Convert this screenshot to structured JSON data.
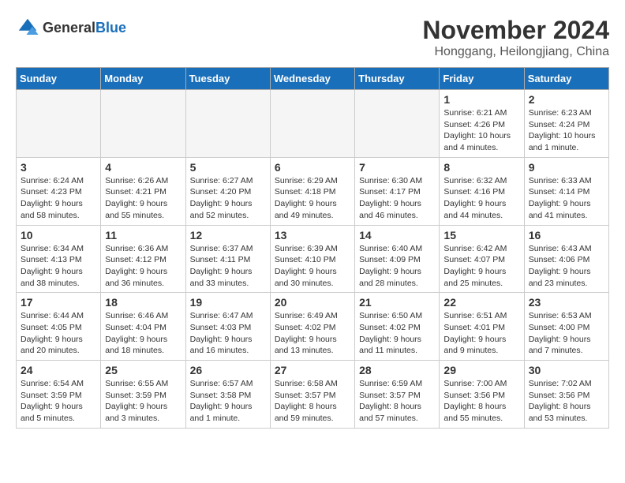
{
  "header": {
    "logo_general": "General",
    "logo_blue": "Blue",
    "month_title": "November 2024",
    "location": "Honggang, Heilongjiang, China"
  },
  "weekdays": [
    "Sunday",
    "Monday",
    "Tuesday",
    "Wednesday",
    "Thursday",
    "Friday",
    "Saturday"
  ],
  "weeks": [
    [
      {
        "day": "",
        "info": ""
      },
      {
        "day": "",
        "info": ""
      },
      {
        "day": "",
        "info": ""
      },
      {
        "day": "",
        "info": ""
      },
      {
        "day": "",
        "info": ""
      },
      {
        "day": "1",
        "info": "Sunrise: 6:21 AM\nSunset: 4:26 PM\nDaylight: 10 hours\nand 4 minutes."
      },
      {
        "day": "2",
        "info": "Sunrise: 6:23 AM\nSunset: 4:24 PM\nDaylight: 10 hours\nand 1 minute."
      }
    ],
    [
      {
        "day": "3",
        "info": "Sunrise: 6:24 AM\nSunset: 4:23 PM\nDaylight: 9 hours\nand 58 minutes."
      },
      {
        "day": "4",
        "info": "Sunrise: 6:26 AM\nSunset: 4:21 PM\nDaylight: 9 hours\nand 55 minutes."
      },
      {
        "day": "5",
        "info": "Sunrise: 6:27 AM\nSunset: 4:20 PM\nDaylight: 9 hours\nand 52 minutes."
      },
      {
        "day": "6",
        "info": "Sunrise: 6:29 AM\nSunset: 4:18 PM\nDaylight: 9 hours\nand 49 minutes."
      },
      {
        "day": "7",
        "info": "Sunrise: 6:30 AM\nSunset: 4:17 PM\nDaylight: 9 hours\nand 46 minutes."
      },
      {
        "day": "8",
        "info": "Sunrise: 6:32 AM\nSunset: 4:16 PM\nDaylight: 9 hours\nand 44 minutes."
      },
      {
        "day": "9",
        "info": "Sunrise: 6:33 AM\nSunset: 4:14 PM\nDaylight: 9 hours\nand 41 minutes."
      }
    ],
    [
      {
        "day": "10",
        "info": "Sunrise: 6:34 AM\nSunset: 4:13 PM\nDaylight: 9 hours\nand 38 minutes."
      },
      {
        "day": "11",
        "info": "Sunrise: 6:36 AM\nSunset: 4:12 PM\nDaylight: 9 hours\nand 36 minutes."
      },
      {
        "day": "12",
        "info": "Sunrise: 6:37 AM\nSunset: 4:11 PM\nDaylight: 9 hours\nand 33 minutes."
      },
      {
        "day": "13",
        "info": "Sunrise: 6:39 AM\nSunset: 4:10 PM\nDaylight: 9 hours\nand 30 minutes."
      },
      {
        "day": "14",
        "info": "Sunrise: 6:40 AM\nSunset: 4:09 PM\nDaylight: 9 hours\nand 28 minutes."
      },
      {
        "day": "15",
        "info": "Sunrise: 6:42 AM\nSunset: 4:07 PM\nDaylight: 9 hours\nand 25 minutes."
      },
      {
        "day": "16",
        "info": "Sunrise: 6:43 AM\nSunset: 4:06 PM\nDaylight: 9 hours\nand 23 minutes."
      }
    ],
    [
      {
        "day": "17",
        "info": "Sunrise: 6:44 AM\nSunset: 4:05 PM\nDaylight: 9 hours\nand 20 minutes."
      },
      {
        "day": "18",
        "info": "Sunrise: 6:46 AM\nSunset: 4:04 PM\nDaylight: 9 hours\nand 18 minutes."
      },
      {
        "day": "19",
        "info": "Sunrise: 6:47 AM\nSunset: 4:03 PM\nDaylight: 9 hours\nand 16 minutes."
      },
      {
        "day": "20",
        "info": "Sunrise: 6:49 AM\nSunset: 4:02 PM\nDaylight: 9 hours\nand 13 minutes."
      },
      {
        "day": "21",
        "info": "Sunrise: 6:50 AM\nSunset: 4:02 PM\nDaylight: 9 hours\nand 11 minutes."
      },
      {
        "day": "22",
        "info": "Sunrise: 6:51 AM\nSunset: 4:01 PM\nDaylight: 9 hours\nand 9 minutes."
      },
      {
        "day": "23",
        "info": "Sunrise: 6:53 AM\nSunset: 4:00 PM\nDaylight: 9 hours\nand 7 minutes."
      }
    ],
    [
      {
        "day": "24",
        "info": "Sunrise: 6:54 AM\nSunset: 3:59 PM\nDaylight: 9 hours\nand 5 minutes."
      },
      {
        "day": "25",
        "info": "Sunrise: 6:55 AM\nSunset: 3:59 PM\nDaylight: 9 hours\nand 3 minutes."
      },
      {
        "day": "26",
        "info": "Sunrise: 6:57 AM\nSunset: 3:58 PM\nDaylight: 9 hours\nand 1 minute."
      },
      {
        "day": "27",
        "info": "Sunrise: 6:58 AM\nSunset: 3:57 PM\nDaylight: 8 hours\nand 59 minutes."
      },
      {
        "day": "28",
        "info": "Sunrise: 6:59 AM\nSunset: 3:57 PM\nDaylight: 8 hours\nand 57 minutes."
      },
      {
        "day": "29",
        "info": "Sunrise: 7:00 AM\nSunset: 3:56 PM\nDaylight: 8 hours\nand 55 minutes."
      },
      {
        "day": "30",
        "info": "Sunrise: 7:02 AM\nSunset: 3:56 PM\nDaylight: 8 hours\nand 53 minutes."
      }
    ]
  ]
}
